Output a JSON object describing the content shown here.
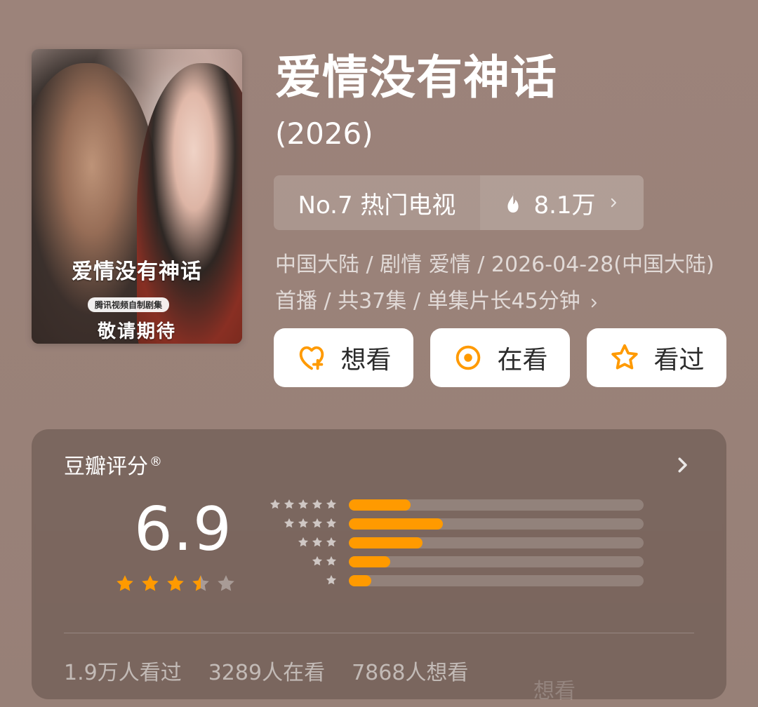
{
  "poster": {
    "title_text": "爱情没有神话",
    "tag_text": "腾讯视频自制剧集",
    "cta_text": "敬请期待"
  },
  "title": {
    "main": "爱情没有神话",
    "year": "(2026)"
  },
  "rank": {
    "label": "No.7 热门电视",
    "heat": "8.1万",
    "icons": {
      "fire": "fire-icon",
      "chevron": "chevron-right-icon"
    }
  },
  "meta": {
    "text": "中国大陆 / 剧情 爱情 / 2026-04-28(中国大陆)首播 / 共37集 / 单集片长45分钟",
    "chevron_icon": "chevron-right-icon"
  },
  "actions": [
    {
      "label": "想看",
      "icon": "heart-plus-icon"
    },
    {
      "label": "在看",
      "icon": "target-icon"
    },
    {
      "label": "看过",
      "icon": "star-outline-icon"
    }
  ],
  "rating": {
    "header": "豆瓣评分",
    "registered": "®",
    "score": "6.9",
    "stars_value": 3.5,
    "distribution": [
      {
        "stars": 5,
        "fraction": 0.21
      },
      {
        "stars": 4,
        "fraction": 0.32
      },
      {
        "stars": 3,
        "fraction": 0.25
      },
      {
        "stars": 2,
        "fraction": 0.14
      },
      {
        "stars": 1,
        "fraction": 0.075
      }
    ],
    "stats": {
      "watched": "1.9万人看过",
      "watching": "3289人在看",
      "want": "7868人想看"
    }
  },
  "colors": {
    "accent": "#ff9a00",
    "bg": "#9b8279",
    "white": "#ffffff"
  },
  "overlay": {
    "bottom_watermark": "想看"
  }
}
